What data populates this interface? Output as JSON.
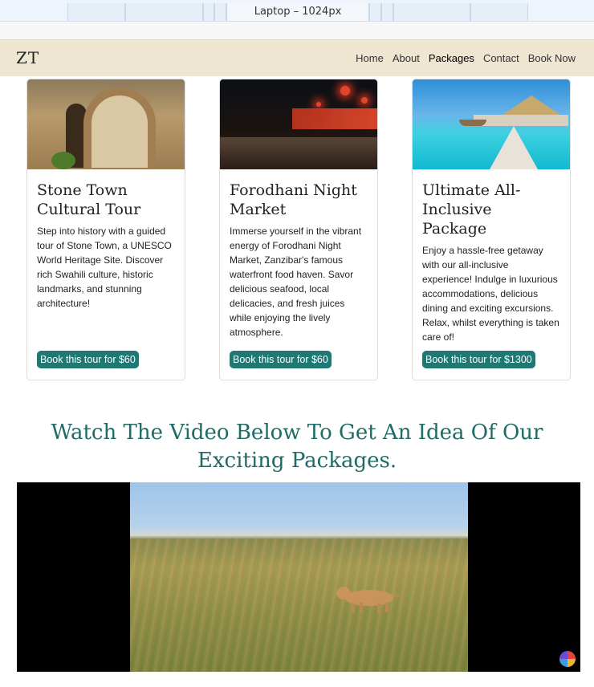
{
  "devtools": {
    "viewport_label": "Laptop – 1024px"
  },
  "navbar": {
    "brand": "ZT",
    "links": [
      {
        "label": "Home"
      },
      {
        "label": "About"
      },
      {
        "label": "Packages"
      },
      {
        "label": "Contact"
      },
      {
        "label": "Book Now"
      }
    ]
  },
  "cards": [
    {
      "title": "Stone Town Cultural Tour",
      "description": "Step into history with a guided tour of Stone Town, a UNESCO World Heritage Site. Discover rich Swahili culture, historic landmarks, and stunning architecture!",
      "button": "Book this tour for $60"
    },
    {
      "title": "Forodhani Night Market",
      "description": "Immerse yourself in the vibrant energy of Forodhani Night Market, Zanzibar's famous waterfront food haven. Savor delicious seafood, local delicacies, and fresh juices while enjoying the lively atmosphere.",
      "button": "Book this tour for $60"
    },
    {
      "title": "Ultimate All-Inclusive Package",
      "description": "Enjoy a hassle-free getaway with our all-inclusive experience! Indulge in luxurious accommodations, delicious dining and exciting excursions. Relax, whilst everything is taken care of!",
      "button": "Book this tour for $1300"
    }
  ],
  "video_section": {
    "heading": "Watch The Video Below To Get An Idea Of Our Exciting Packages."
  },
  "colors": {
    "accent": "#217873",
    "heading": "#1f6b66",
    "navbar_bg": "#efe6d2"
  }
}
